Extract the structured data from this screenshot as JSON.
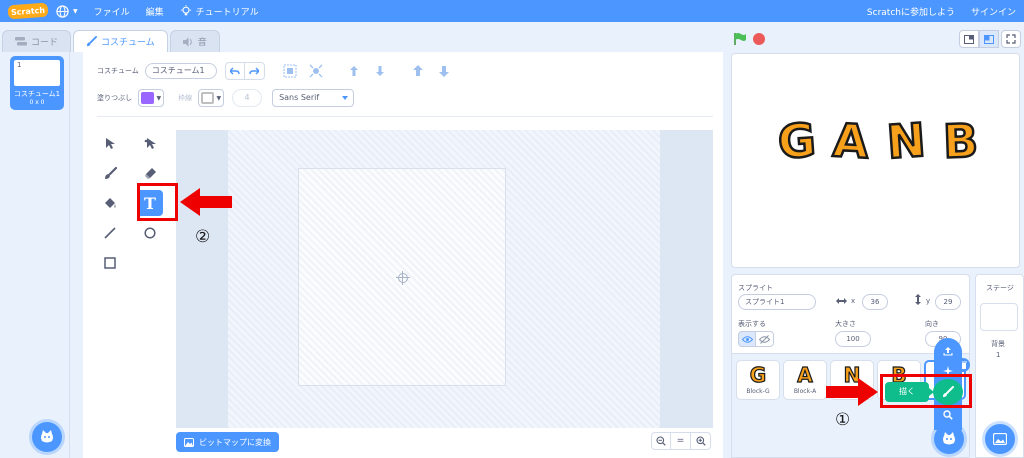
{
  "menubar": {
    "logo": "Scratch",
    "file": "ファイル",
    "edit": "編集",
    "tutorials": "チュートリアル",
    "join": "Scratchに参加しよう",
    "signin": "サインイン"
  },
  "tabs": [
    {
      "label": "コード"
    },
    {
      "label": "コスチューム"
    },
    {
      "label": "音"
    }
  ],
  "costumes": [
    {
      "number": "1",
      "name": "コスチューム1",
      "size": "0 x 0"
    }
  ],
  "paint": {
    "costume_label": "コスチューム",
    "costume_name": "コスチューム1",
    "fill_label": "塗りつぶし",
    "fill_color": "#9966ff",
    "outline_label": "枠線",
    "outline_color": "#bfbfbf",
    "outline_width": "4",
    "font": "Sans Serif",
    "bitmap_button": "ビットマップに変換"
  },
  "stage_text": [
    "G",
    "A",
    "N",
    "B"
  ],
  "sprite": {
    "sprite_label": "スプライト",
    "sprite_name": "スプライト1",
    "x_label": "x",
    "x_value": "36",
    "y_label": "y",
    "y_value": "29",
    "show_label": "表示する",
    "size_label": "大きさ",
    "size_value": "100",
    "direction_label": "向き",
    "direction_value": "90"
  },
  "sprites": [
    {
      "glyph": "G",
      "name": "Block-G"
    },
    {
      "glyph": "A",
      "name": "Block-A"
    },
    {
      "glyph": "N",
      "name": ""
    },
    {
      "glyph": "B",
      "name": ""
    }
  ],
  "stage_panel": {
    "title": "ステージ",
    "backdrops_label": "背景",
    "backdrops_count": "1"
  },
  "popup": {
    "paint_tooltip": "描く"
  },
  "annotations": {
    "step1": "①",
    "step2": "②"
  },
  "colors": {
    "accent": "#4c97ff",
    "annotation_red": "#ee0000",
    "paint_green": "#0fbd8c"
  }
}
